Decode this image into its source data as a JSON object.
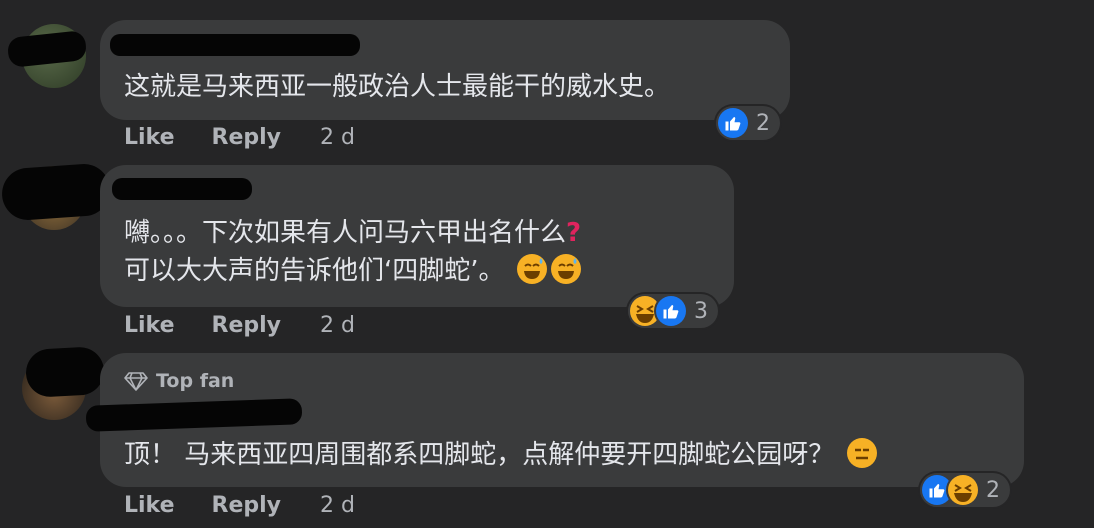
{
  "comments": [
    {
      "text_lines": [
        "这就是马来西亚一般政治人士最能干的威水史。"
      ],
      "actions": {
        "like": "Like",
        "reply": "Reply",
        "time": "2 d"
      },
      "reaction_count": "2",
      "reaction_icons": [
        "like-icon"
      ]
    },
    {
      "text_lines": [
        "嚩。。。下次如果有人问马六甲出名什么",
        "可以大大声的告诉他们‘四脚蛇’。"
      ],
      "actions": {
        "like": "Like",
        "reply": "Reply",
        "time": "2 d"
      },
      "reaction_count": "3",
      "reaction_icons": [
        "haha-icon",
        "like-icon"
      ],
      "inline_emoji": [
        "question-mark-icon",
        "sweat-smile-emoji",
        "sweat-smile-emoji"
      ]
    },
    {
      "badge": "Top fan",
      "text_lines": [
        "顶！ 马来西亚四周围都系四脚蛇，点解仲要开四脚蛇公园呀？"
      ],
      "actions": {
        "like": "Like",
        "reply": "Reply",
        "time": "2 d"
      },
      "reaction_count": "2",
      "reaction_icons": [
        "like-icon",
        "haha-icon"
      ],
      "inline_emoji": [
        "expressionless-emoji"
      ]
    }
  ],
  "colors": {
    "background": "#252526",
    "bubble": "#3a3b3c",
    "text": "#e4e6eb",
    "muted": "#b0b3b8",
    "like_blue": "#1877f2",
    "haha_yellow": "#f7b125"
  }
}
